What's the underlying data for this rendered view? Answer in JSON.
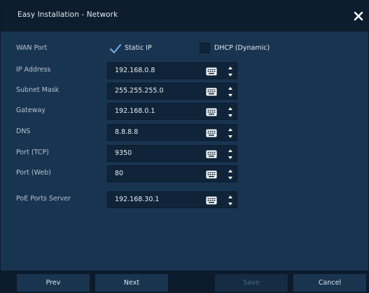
{
  "window": {
    "title": "Easy Installation - Network"
  },
  "wan_port": {
    "label": "WAN Port",
    "static_ip": {
      "label": "Static IP",
      "checked": true
    },
    "dhcp": {
      "label": "DHCP (Dynamic)",
      "checked": false
    }
  },
  "fields": {
    "ip_address": {
      "label": "IP Address",
      "value": "192.168.0.8"
    },
    "subnet_mask": {
      "label": "Subnet Mask",
      "value": "255.255.255.0"
    },
    "gateway": {
      "label": "Gateway",
      "value": "192.168.0.1"
    },
    "dns": {
      "label": "DNS",
      "value": "8.8.8.8"
    },
    "port_tcp": {
      "label": "Port (TCP)",
      "value": "9350"
    },
    "port_web": {
      "label": "Port (Web)",
      "value": "80"
    },
    "poe_server": {
      "label": "PoE Ports Server",
      "value": "192.168.30.1"
    }
  },
  "footer": {
    "prev": "Prev",
    "next": "Next",
    "save": "Save",
    "cancel": "Cancel"
  },
  "colors": {
    "background": "#183450",
    "titlebar": "#0d1d2e",
    "field": "#0f2438",
    "check_accent": "#6fb0ea"
  },
  "icons": {
    "close": "close-icon",
    "keyboard": "keyboard-icon",
    "spinner": "up-down-spinner-icon",
    "check": "check-icon"
  }
}
